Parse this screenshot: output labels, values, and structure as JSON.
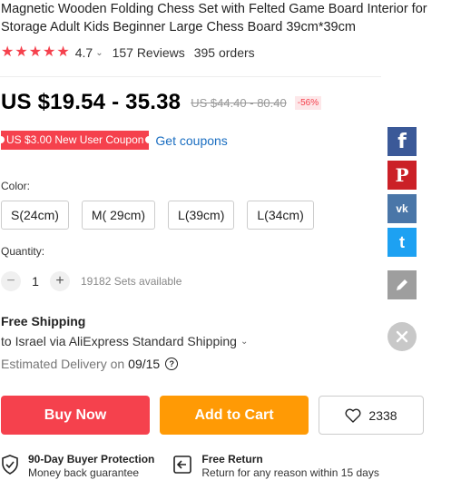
{
  "product": {
    "title": "Magnetic Wooden Folding Chess Set with Felted Game Board Interior for Storage Adult Kids Beginner Large Chess Board 39cm*39cm"
  },
  "rating": {
    "stars": 5,
    "value": "4.7",
    "reviews": "157 Reviews",
    "orders": "395 orders"
  },
  "pricing": {
    "price": "US $19.54 - 35.38",
    "original": "US $44.40 - 80.40",
    "discount": "-56%"
  },
  "coupon": {
    "label": "US $3.00 New User Coupon",
    "link": "Get coupons"
  },
  "color": {
    "label": "Color:",
    "options": [
      "S(24cm)",
      "M( 29cm)",
      "L(39cm)",
      "L(34cm)"
    ]
  },
  "quantity": {
    "label": "Quantity:",
    "minus": "−",
    "value": "1",
    "plus": "+",
    "available": "19182 Sets available"
  },
  "shipping": {
    "title": "Free Shipping",
    "destination": "to Israel via AliExpress Standard Shipping",
    "estimated_label": "Estimated Delivery on",
    "date": "09/15"
  },
  "actions": {
    "buy": "Buy Now",
    "cart": "Add to Cart",
    "wishlist_count": "2338"
  },
  "guarantees": [
    {
      "title": "90-Day Buyer Protection",
      "sub": "Money back guarantee"
    },
    {
      "title": "Free Return",
      "sub": "Return for any reason within 15 days"
    }
  ],
  "share": {
    "facebook": "f",
    "pinterest": "P",
    "vk": "vk",
    "twitter": "t"
  },
  "colors": {
    "accent": "#f5414d",
    "cart": "#ff9a05",
    "link": "#1a6ec1"
  }
}
